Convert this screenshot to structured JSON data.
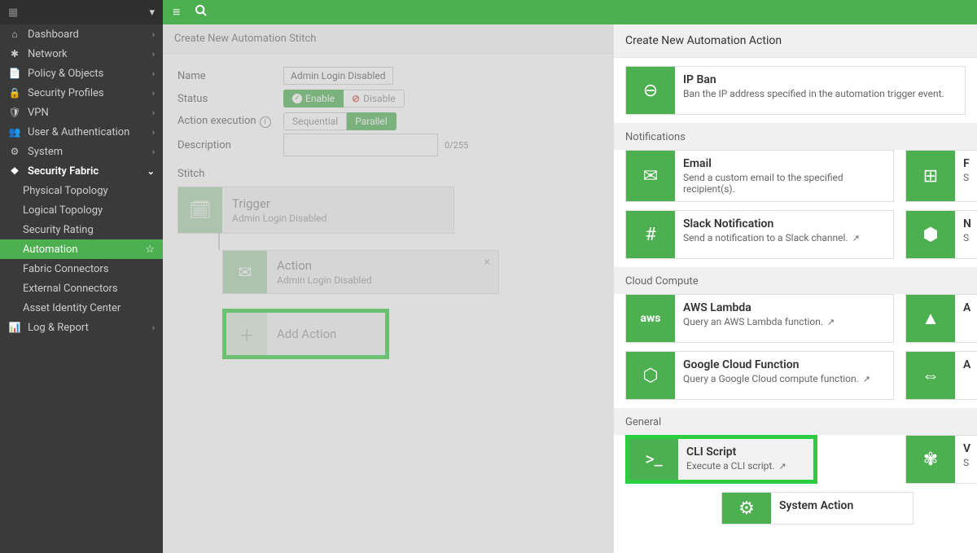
{
  "brand": "",
  "nav": {
    "dashboard": "Dashboard",
    "network": "Network",
    "policy": "Policy & Objects",
    "security_profiles": "Security Profiles",
    "vpn": "VPN",
    "user_auth": "User & Authentication",
    "system": "System",
    "security_fabric": "Security Fabric",
    "sub": {
      "physical": "Physical Topology",
      "logical": "Logical Topology",
      "rating": "Security Rating",
      "automation": "Automation",
      "fabric_conn": "Fabric Connectors",
      "external_conn": "External Connectors",
      "asset_id": "Asset Identity Center"
    },
    "log_report": "Log & Report"
  },
  "breadcrumb": "Create New Automation Stitch",
  "form": {
    "name_label": "Name",
    "name_value": "Admin Login Disabled",
    "status_label": "Status",
    "status_enable": "Enable",
    "status_disable": "Disable",
    "exec_label": "Action execution",
    "exec_seq": "Sequential",
    "exec_par": "Parallel",
    "desc_label": "Description",
    "desc_counter": "0/255"
  },
  "stitch": {
    "h": "Stitch",
    "trigger_title": "Trigger",
    "trigger_sub": "Admin Login Disabled",
    "action_title": "Action",
    "action_sub": "Admin Login Disabled",
    "add_action": "Add Action"
  },
  "panel": {
    "title": "Create New Automation Action",
    "ipban": {
      "title": "IP Ban",
      "desc": "Ban the IP address specified in the automation trigger event."
    },
    "notifications_h": "Notifications",
    "email": {
      "title": "Email",
      "desc": "Send a custom email to the specified recipient(s)."
    },
    "teams_p": {
      "title": "F",
      "desc": "S"
    },
    "slack": {
      "title": "Slack Notification",
      "desc": "Send a notification to a Slack channel."
    },
    "teams_n": {
      "title": "N",
      "desc": "S"
    },
    "cloud_h": "Cloud Compute",
    "aws": {
      "title": "AWS Lambda",
      "desc": "Query an AWS Lambda function."
    },
    "azure_a": {
      "title": "A"
    },
    "gcf": {
      "title": "Google Cloud Function",
      "desc": "Query a Google Cloud compute function."
    },
    "ali_a": {
      "title": "A"
    },
    "general_h": "General",
    "cli": {
      "title": "CLI Script",
      "desc": "Execute a CLI script."
    },
    "webhook_w": {
      "title": "V",
      "desc": "S"
    },
    "sysact": {
      "title": "System Action"
    }
  }
}
